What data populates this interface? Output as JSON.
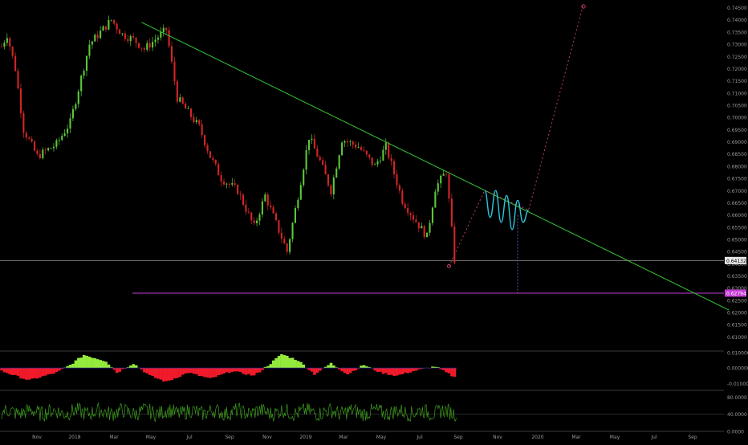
{
  "colors": {
    "background": "#000000",
    "candle_up": "#5cc83a",
    "candle_down": "#d42525",
    "trendline": "#35c635",
    "projection": "#2ac7dc",
    "target_line": "#c43bd6",
    "dotted_path": "#c03b6a",
    "osc_positive": "#94ea3c",
    "osc_negative": "#f01a2a",
    "rsi": "#3e9b1f",
    "axis_text": "#9a9a9a",
    "separator": "#3a3a3a"
  },
  "chart_data": [
    {
      "type": "candlestick",
      "title": "",
      "x_axis": {
        "tick_labels": [
          "Nov",
          "2018",
          "Mar",
          "May",
          "Jul",
          "Sep",
          "Nov",
          "2019",
          "Mar",
          "May",
          "Jul",
          "Sep",
          "Nov",
          "2020",
          "Mar",
          "May",
          "Jul",
          "Sep"
        ]
      },
      "y_axis": {
        "ylim": [
          0.6075,
          0.7465
        ],
        "tick_labels": [
          "0.74500",
          "0.74000",
          "0.73500",
          "0.73000",
          "0.72500",
          "0.72000",
          "0.71500",
          "0.71000",
          "0.70500",
          "0.70000",
          "0.69500",
          "0.69000",
          "0.68500",
          "0.68000",
          "0.67500",
          "0.67000",
          "0.66500",
          "0.66000",
          "0.65500",
          "0.65000",
          "0.64500",
          "0.64000",
          "0.63500",
          "0.63000",
          "0.62500",
          "0.62000",
          "0.61500",
          "0.61000"
        ],
        "position": "right"
      },
      "anchors": {
        "t": [
          0,
          2,
          5,
          8,
          13,
          20,
          25,
          32,
          40,
          44,
          48,
          52,
          60,
          64,
          72,
          76,
          80,
          86,
          92,
          96,
          104,
          108,
          112,
          116,
          120,
          124,
          130,
          136,
          140,
          146,
          150,
          155,
          158,
          162,
          165
        ],
        "price": [
          0.729,
          0.734,
          0.72,
          0.695,
          0.684,
          0.689,
          0.698,
          0.73,
          0.74,
          0.734,
          0.732,
          0.728,
          0.736,
          0.708,
          0.696,
          0.684,
          0.675,
          0.67,
          0.655,
          0.668,
          0.645,
          0.668,
          0.692,
          0.682,
          0.67,
          0.691,
          0.688,
          0.68,
          0.688,
          0.666,
          0.659,
          0.651,
          0.671,
          0.678,
          0.6415
        ]
      },
      "levels": {
        "current_price": 0.64132,
        "current_price_label": "0.64132",
        "target_price": 0.62794,
        "target_price_label": "0.62794"
      },
      "trendline": {
        "from": {
          "t": 51,
          "price": 0.739
        },
        "to": {
          "t": 265,
          "price": 0.621
        }
      },
      "projection_wave": {
        "t": [
          176,
          178,
          180,
          182,
          184,
          186,
          188,
          190,
          192
        ],
        "price": [
          0.67,
          0.659,
          0.67,
          0.657,
          0.668,
          0.654,
          0.666,
          0.657,
          0.662
        ]
      },
      "dotted_path": {
        "t": [
          163,
          176,
          192,
          212
        ],
        "price": [
          0.639,
          0.67,
          0.662,
          0.7465
        ]
      }
    },
    {
      "type": "histogram",
      "title": "",
      "y_axis": {
        "tick_labels": [
          "0.010000",
          "0.000000",
          "-0.010000"
        ],
        "ylim": [
          -0.0135,
          0.0105
        ]
      },
      "anchors": {
        "t": [
          0,
          10,
          20,
          25,
          30,
          38,
          42,
          48,
          54,
          60,
          68,
          76,
          84,
          92,
          98,
          102,
          108,
          114,
          120,
          126,
          132,
          138,
          144,
          150,
          158,
          165
        ],
        "value": [
          -0.002,
          -0.008,
          -0.003,
          0.002,
          0.0085,
          0.0045,
          -0.003,
          0.003,
          -0.005,
          -0.009,
          -0.003,
          -0.007,
          -0.002,
          -0.005,
          0.003,
          0.009,
          0.005,
          -0.004,
          0.003,
          -0.004,
          0.002,
          -0.003,
          -0.005,
          -0.002,
          0.001,
          -0.006
        ]
      }
    },
    {
      "type": "line",
      "title": "",
      "y_axis": {
        "tick_labels": [
          "80.0000",
          "40.0000",
          "0.0000"
        ],
        "ylim": [
          0,
          90
        ]
      },
      "center": 45,
      "amplitude": 18
    }
  ]
}
